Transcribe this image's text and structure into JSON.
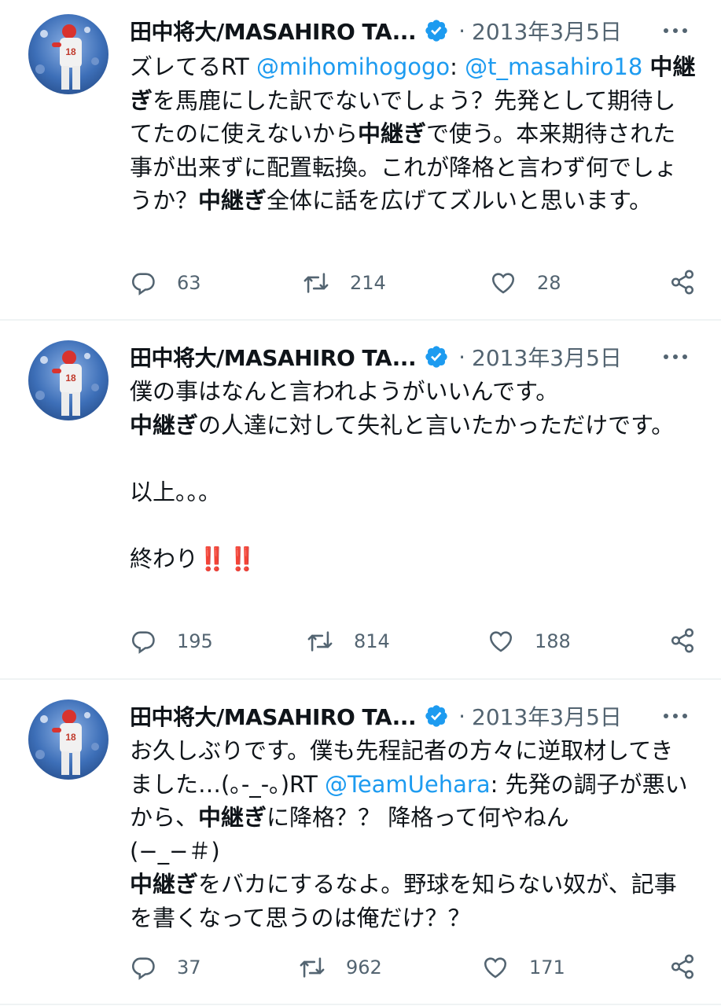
{
  "colors": {
    "accent": "#1d9bf0",
    "muted": "#536471",
    "text": "#0f1419",
    "emoji_red": "#e0245e"
  },
  "tweets": [
    {
      "author_name": "田中将大/MASAHIRO TA...",
      "separator": "·",
      "date": "2013年3月5日",
      "segments": [
        {
          "text": "ズレてるRT ",
          "style": "normal"
        },
        {
          "text": "@mihomihogogo",
          "style": "mention"
        },
        {
          "text": ": ",
          "style": "normal"
        },
        {
          "text": "@t_masahiro18",
          "style": "mention"
        },
        {
          "text": " ",
          "style": "normal"
        },
        {
          "text": "中継ぎ",
          "style": "bold"
        },
        {
          "text": "を馬鹿にした訳でないでしょう？先発として期待してたのに使えないから",
          "style": "normal"
        },
        {
          "text": "中継ぎ",
          "style": "bold"
        },
        {
          "text": "で使う。本来期待された事が出来ずに配置転換。これが降格と言わず何でしょうか？",
          "style": "normal"
        },
        {
          "text": "中継ぎ",
          "style": "bold"
        },
        {
          "text": "全体に話を広げてズルいと思います。",
          "style": "normal"
        }
      ],
      "reply_count": "63",
      "retweet_count": "214",
      "like_count": "28"
    },
    {
      "author_name": "田中将大/MASAHIRO TA...",
      "separator": "·",
      "date": "2013年3月5日",
      "segments": [
        {
          "text": "僕の事はなんと言われようがいいんです。",
          "style": "normal"
        },
        {
          "text": "\n",
          "style": "br"
        },
        {
          "text": "中継ぎ",
          "style": "bold"
        },
        {
          "text": "の人達に対して失礼と言いたかっただけです。",
          "style": "normal"
        },
        {
          "text": "\n",
          "style": "br"
        },
        {
          "text": "\n",
          "style": "br"
        },
        {
          "text": "以上。。。",
          "style": "normal"
        },
        {
          "text": "\n",
          "style": "br"
        },
        {
          "text": "\n",
          "style": "br"
        },
        {
          "text": "終わり",
          "style": "normal"
        },
        {
          "text": "‼️‼️",
          "style": "red"
        }
      ],
      "reply_count": "195",
      "retweet_count": "814",
      "like_count": "188"
    },
    {
      "author_name": "田中将大/MASAHIRO TA...",
      "separator": "·",
      "date": "2013年3月5日",
      "segments": [
        {
          "text": "お久しぶりです。僕も先程記者の方々に逆取材してきました…(｡-_-｡)RT ",
          "style": "normal"
        },
        {
          "text": "@TeamUehara",
          "style": "mention"
        },
        {
          "text": ": 先発の調子が悪いから、",
          "style": "normal"
        },
        {
          "text": "中継ぎ",
          "style": "bold"
        },
        {
          "text": "に降格？？ 降格って何やねん",
          "style": "normal"
        },
        {
          "text": "\n",
          "style": "br"
        },
        {
          "text": "(−_−＃)",
          "style": "normal"
        },
        {
          "text": "\n",
          "style": "br"
        },
        {
          "text": "中継ぎ",
          "style": "bold"
        },
        {
          "text": "をバカにするなよ。野球を知らない奴が、記事を書くなって思うのは俺だけ？？",
          "style": "normal"
        }
      ],
      "reply_count": "37",
      "retweet_count": "962",
      "like_count": "171"
    }
  ]
}
